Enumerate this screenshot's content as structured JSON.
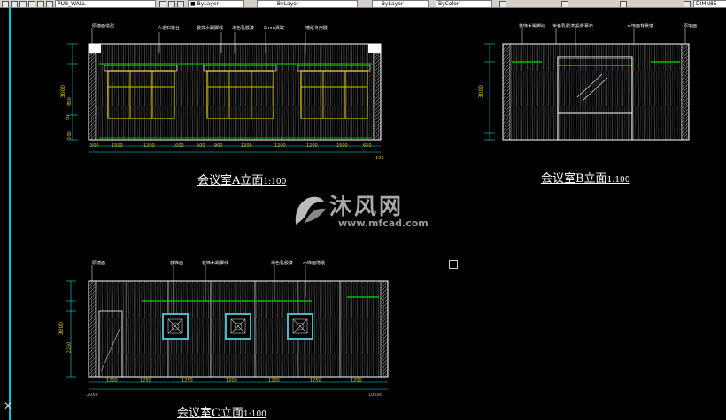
{
  "toolbar": {
    "layer_name": "PUB_WALL",
    "color_control": "ByLayer",
    "linetype_control": "ByLayer",
    "lineweight_control": "ByLayer",
    "plot_style": "ByColor",
    "dim_style": "DIMN85"
  },
  "elevation_a": {
    "title": "会议室A立面",
    "scale": "1:100",
    "annotations": [
      "原墙面造型",
      "人造石窗台",
      "装饰木踢脚线",
      "米色乳胶漆",
      "8mm清玻",
      "墙纸专用胶"
    ],
    "left_dims": [
      "3000",
      "50",
      "800",
      "100"
    ],
    "bottom_dims": [
      "500",
      "1500",
      "1200",
      "1000",
      "500",
      "900",
      "1200",
      "1200",
      "1200",
      "1500",
      "650"
    ],
    "extra_dim": "150"
  },
  "elevation_b": {
    "title": "会议室B立面",
    "scale": "1:100",
    "annotations": [
      "装饰木踢脚线",
      "米色乳胶漆",
      "投影幕布",
      "木饰面背景墙",
      "原墙面"
    ],
    "left_dims": [
      "3000"
    ]
  },
  "elevation_c": {
    "title": "会议室C立面",
    "scale": "1:100",
    "annotations": [
      "原墙面",
      "装饰画",
      "装饰木踢脚线",
      "米色乳胶漆",
      "木饰面墙纸"
    ],
    "left_dims": [
      "3000",
      "2250"
    ],
    "bottom_dims": [
      "2050",
      "1200",
      "1250",
      "1250",
      "1200",
      "1200",
      "1250",
      "1200",
      "10690"
    ]
  },
  "watermark": {
    "brand": "沐风网",
    "url": "www.mfcad.com"
  },
  "colors": {
    "background": "#000000",
    "lines": "#ffffff",
    "accent_green": "#00e000",
    "accent_yellow": "#d8c000",
    "accent_cyan": "#00c8d8",
    "dim_line": "#00e0e0"
  }
}
